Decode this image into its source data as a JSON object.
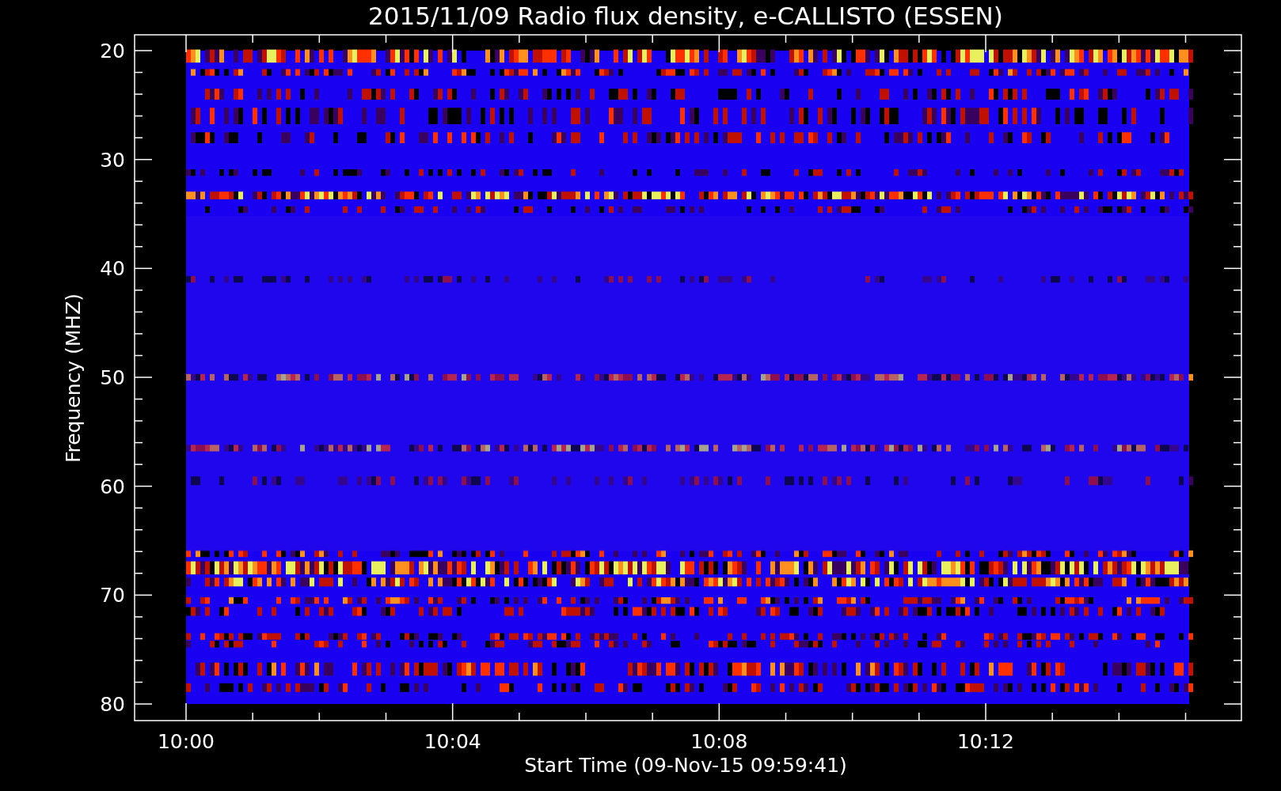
{
  "title": "2015/11/09  Radio flux density, e-CALLISTO (ESSEN)",
  "y_axis": {
    "label": "Frequency (MHZ)",
    "ticks": [
      "20",
      "30",
      "40",
      "50",
      "60",
      "70",
      "80"
    ]
  },
  "x_axis": {
    "label": "Start Time (09-Nov-15 09:59:41)",
    "ticks": [
      "10:00",
      "10:04",
      "10:08",
      "10:12"
    ]
  }
}
